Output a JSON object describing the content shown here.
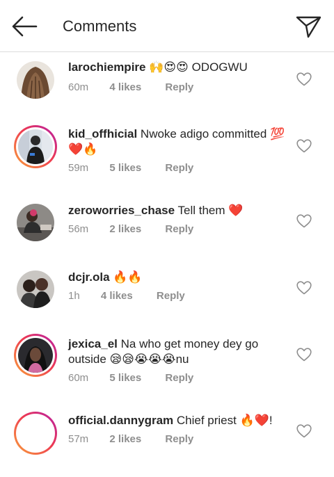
{
  "header": {
    "title": "Comments"
  },
  "comments": [
    {
      "username": "larochiempire",
      "text": "🙌😍😍 ODOGWU",
      "time": "60m",
      "likes": "4 likes",
      "reply": "Reply",
      "avatar": "hair",
      "ring": false
    },
    {
      "username": "kid_offhicial",
      "text": "Nwoke adigo committed 💯❤️🔥",
      "time": "59m",
      "likes": "5 likes",
      "reply": "Reply",
      "avatar": "person-dark",
      "ring": true
    },
    {
      "username": "zeroworries_chase",
      "text": "Tell them ❤️",
      "time": "56m",
      "likes": "2 likes",
      "reply": "Reply",
      "avatar": "person-desk",
      "ring": false
    },
    {
      "username": "dcjr.ola",
      "text": "🔥🔥",
      "time": "1h",
      "likes": "4 likes",
      "reply": "Reply",
      "avatar": "couple",
      "ring": false
    },
    {
      "username": "jexica_el",
      "text": "Na who get money dey go outside 😪😪😭😭😭nu",
      "time": "60m",
      "likes": "5 likes",
      "reply": "Reply",
      "avatar": "woman-braids",
      "ring": true
    },
    {
      "username": "official.dannygram",
      "text": "Chief priest 🔥❤️!",
      "time": "57m",
      "likes": "2 likes",
      "reply": "Reply",
      "avatar": "blank",
      "ring": true
    }
  ]
}
